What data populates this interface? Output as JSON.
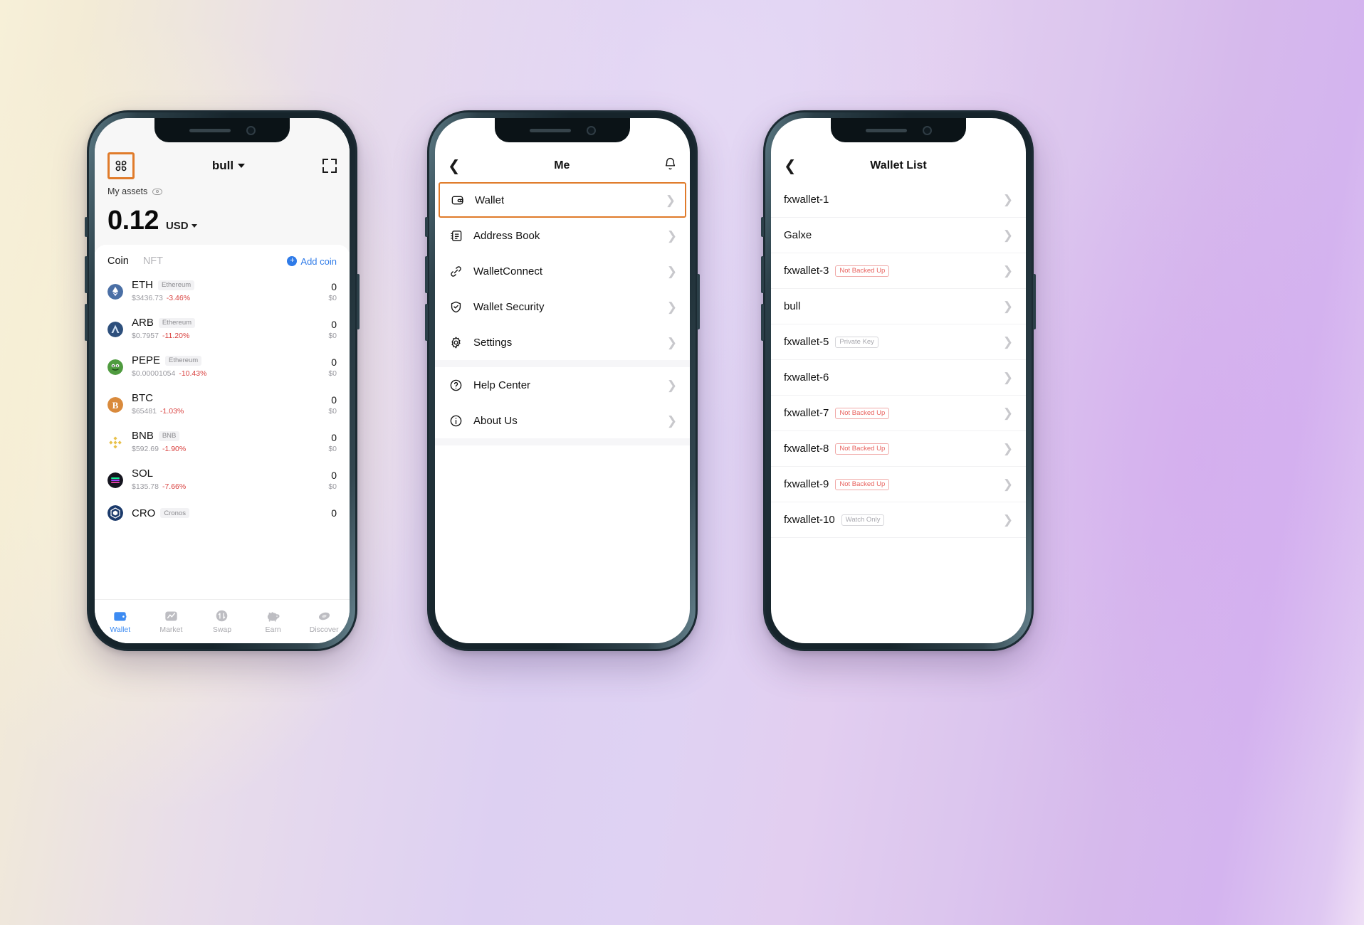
{
  "phone1": {
    "header": {
      "menu_icon": "grid-icon",
      "title": "bull",
      "expand_icon": "fullscreen-icon"
    },
    "assets": {
      "label": "My assets",
      "eye_icon": "eye-icon",
      "balance": "0.12",
      "currency": "USD"
    },
    "tabs": {
      "coin": "Coin",
      "nft": "NFT",
      "add_coin": "Add coin"
    },
    "coins": [
      {
        "symbol": "ETH",
        "chain": "Ethereum",
        "price": "$3436.73",
        "change": "-3.46%",
        "amount": "0",
        "usd": "$0",
        "color": "#4a6fa5"
      },
      {
        "symbol": "ARB",
        "chain": "Ethereum",
        "price": "$0.7957",
        "change": "-11.20%",
        "amount": "0",
        "usd": "$0",
        "color": "#2d4f7c"
      },
      {
        "symbol": "PEPE",
        "chain": "Ethereum",
        "price": "$0.00001054",
        "change": "-10.43%",
        "amount": "0",
        "usd": "$0",
        "color": "#4f9b3f"
      },
      {
        "symbol": "BTC",
        "chain": "",
        "price": "$65481",
        "change": "-1.03%",
        "amount": "0",
        "usd": "$0",
        "color": "#d98a3c"
      },
      {
        "symbol": "BNB",
        "chain": "BNB",
        "price": "$592.69",
        "change": "-1.90%",
        "amount": "0",
        "usd": "$0",
        "color": "#e8c14a"
      },
      {
        "symbol": "SOL",
        "chain": "",
        "price": "$135.78",
        "change": "-7.66%",
        "amount": "0",
        "usd": "$0",
        "color": "#1a1a22"
      },
      {
        "symbol": "CRO",
        "chain": "Cronos",
        "price": "",
        "change": "",
        "amount": "0",
        "usd": "",
        "color": "#1b3a6b"
      }
    ],
    "tabbar": [
      {
        "label": "Wallet",
        "icon": "wallet-icon",
        "active": true
      },
      {
        "label": "Market",
        "icon": "chart-icon",
        "active": false
      },
      {
        "label": "Swap",
        "icon": "swap-icon",
        "active": false
      },
      {
        "label": "Earn",
        "icon": "piggy-icon",
        "active": false
      },
      {
        "label": "Discover",
        "icon": "discover-icon",
        "active": false
      }
    ]
  },
  "phone2": {
    "header": {
      "back_icon": "back-chevron-icon",
      "title": "Me",
      "bell_icon": "bell-icon"
    },
    "menu_group1": [
      {
        "label": "Wallet",
        "icon": "wallet-icon",
        "highlighted": true
      },
      {
        "label": "Address Book",
        "icon": "address-book-icon",
        "highlighted": false
      },
      {
        "label": "WalletConnect",
        "icon": "link-icon",
        "highlighted": false
      },
      {
        "label": "Wallet Security",
        "icon": "shield-check-icon",
        "highlighted": false
      },
      {
        "label": "Settings",
        "icon": "gear-icon",
        "highlighted": false
      }
    ],
    "menu_group2": [
      {
        "label": "Help Center",
        "icon": "question-circle-icon"
      },
      {
        "label": "About Us",
        "icon": "info-circle-icon"
      }
    ]
  },
  "phone3": {
    "header": {
      "back_icon": "back-chevron-icon",
      "title": "Wallet List"
    },
    "wallets": [
      {
        "name": "fxwallet-1",
        "badge": "",
        "badge_type": ""
      },
      {
        "name": "Galxe",
        "badge": "",
        "badge_type": ""
      },
      {
        "name": "fxwallet-3",
        "badge": "Not Backed Up",
        "badge_type": "red"
      },
      {
        "name": "bull",
        "badge": "",
        "badge_type": ""
      },
      {
        "name": "fxwallet-5",
        "badge": "Private Key",
        "badge_type": "gray"
      },
      {
        "name": "fxwallet-6",
        "badge": "",
        "badge_type": ""
      },
      {
        "name": "fxwallet-7",
        "badge": "Not Backed Up",
        "badge_type": "red"
      },
      {
        "name": "fxwallet-8",
        "badge": "Not Backed Up",
        "badge_type": "red"
      },
      {
        "name": "fxwallet-9",
        "badge": "Not Backed Up",
        "badge_type": "red"
      },
      {
        "name": "fxwallet-10",
        "badge": "Watch Only",
        "badge_type": "gray"
      }
    ]
  },
  "colors": {
    "highlight": "#e07b2a",
    "accent": "#2f7be8",
    "negative": "#d9413f",
    "badge_red": "#e8635f",
    "badge_gray": "#a8a8ae"
  }
}
